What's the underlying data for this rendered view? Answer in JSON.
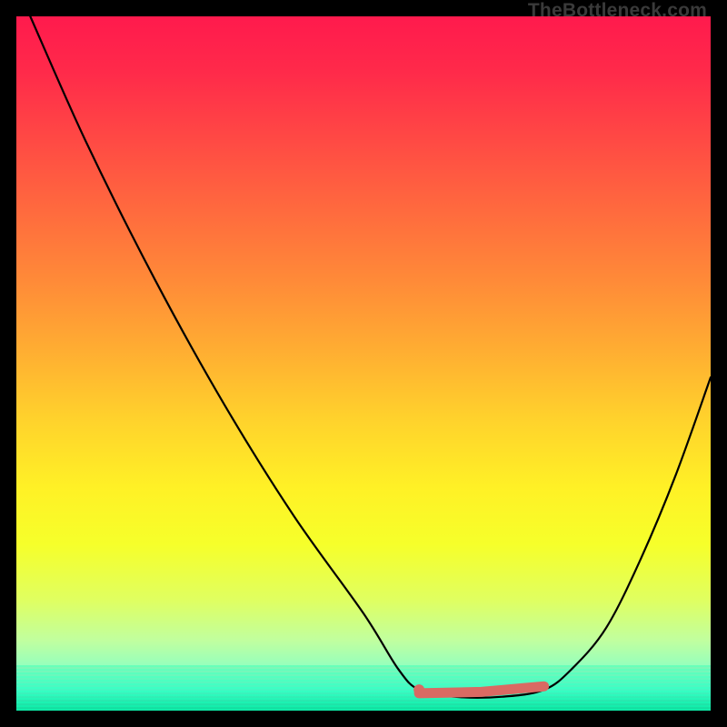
{
  "brand": "TheBottleneck.com",
  "chart_data": {
    "type": "line",
    "title": "",
    "xlabel": "",
    "ylabel": "",
    "xlim": [
      0,
      100
    ],
    "ylim": [
      0,
      100
    ],
    "series": [
      {
        "name": "curve",
        "x": [
          2,
          10,
          20,
          30,
          40,
          50,
          55,
          58,
          63,
          70,
          76,
          80,
          85,
          90,
          95,
          100
        ],
        "y": [
          100,
          82,
          62,
          44,
          28,
          14,
          6,
          3,
          2,
          2,
          3,
          6,
          12,
          22,
          34,
          48
        ]
      }
    ],
    "annotations": [
      {
        "name": "marker-dot",
        "x": 58,
        "y": 3,
        "color": "#d96a63"
      },
      {
        "name": "marker-bar",
        "x0": 58,
        "y0": 2.5,
        "x1": 76,
        "y1": 3.5,
        "color": "#d96a63"
      }
    ],
    "colors": {
      "curve": "#000000",
      "marker": "#d96a63"
    }
  }
}
